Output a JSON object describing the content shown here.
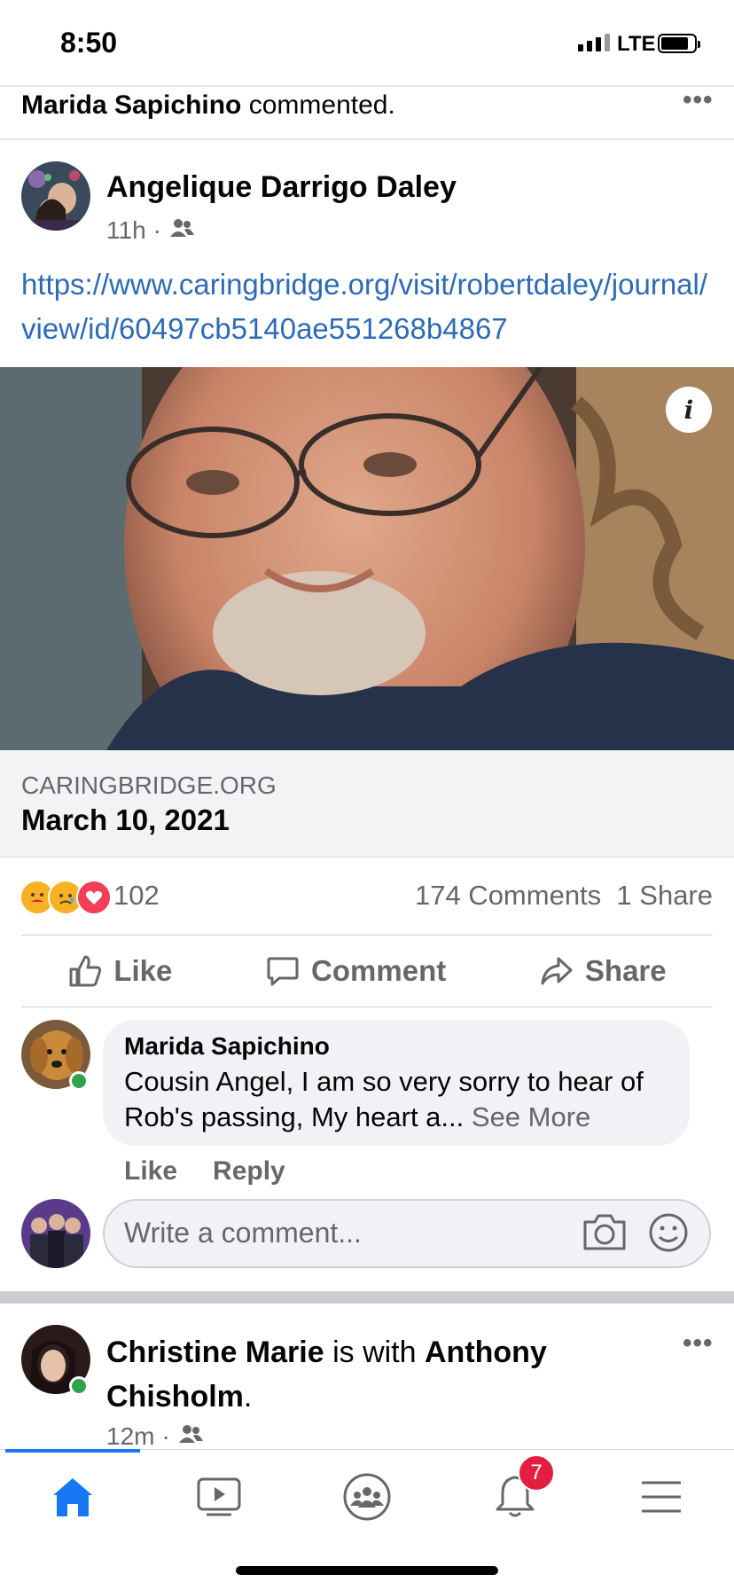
{
  "status_bar": {
    "time": "8:50",
    "network": "LTE"
  },
  "activity": {
    "name": "Marida Sapichino",
    "action": "commented."
  },
  "post": {
    "author": "Angelique Darrigo Daley",
    "time": "11h",
    "link_text": "https://www.caringbridge.org/visit/robertdaley/journal/view/id/60497cb5140ae551268b4867",
    "preview": {
      "domain": "CARINGBRIDGE.ORG",
      "title": "March 10, 2021"
    },
    "reaction_count": "102",
    "comments_count": "174 Comments",
    "shares_count": "1 Share",
    "actions": {
      "like": "Like",
      "comment": "Comment",
      "share": "Share"
    }
  },
  "top_comment": {
    "author": "Marida Sapichino",
    "text": "Cousin Angel,  I am so very sorry to hear of Rob's passing, My heart a...",
    "see_more": "See More",
    "like": "Like",
    "reply": "Reply"
  },
  "composer": {
    "placeholder": "Write a comment..."
  },
  "next_post": {
    "author": "Christine Marie",
    "connector": "is with",
    "with": "Anthony Chisholm",
    "time": "12m"
  },
  "tab_bar": {
    "notifications_badge": "7"
  },
  "colors": {
    "link": "#2d6bb5",
    "accent": "#1877f2",
    "badge": "#e41e3f",
    "online": "#31a24c"
  }
}
